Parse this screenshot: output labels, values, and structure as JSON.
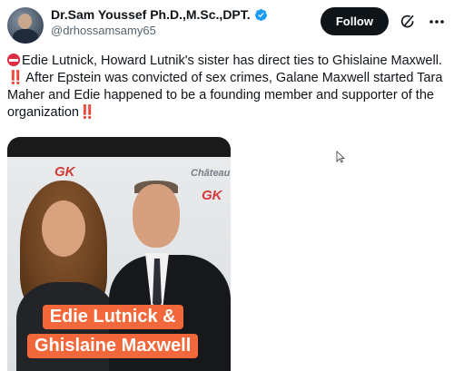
{
  "author": {
    "display_name": "Dr.Sam Youssef Ph.D.,M.Sc.,DPT.",
    "handle": "@drhossamsamy65",
    "verified": true,
    "avatar_icon": "profile-photo"
  },
  "actions": {
    "follow_label": "Follow",
    "grok_icon": "grok-icon",
    "more_icon": "more-dots-icon"
  },
  "post": {
    "paragraph_1": "Edie Lutnick, Howard Lutnik's sister has direct ties to Ghislaine Maxwell.",
    "paragraph_2": "After Epstein was convicted of sex crimes, Galane Maxwell started Tara Maher and Edie happened to be a founding member and supporter of the organization",
    "bang": "‼️"
  },
  "media": {
    "caption_line_1": "Edie Lutnick &",
    "caption_line_2": "Ghislaine Maxwell",
    "backdrop_logo_gk": "GK",
    "backdrop_logo_chateau": "Château",
    "caption_color": "#f2683a"
  },
  "colors": {
    "text_primary": "#0f1419",
    "text_secondary": "#536471",
    "verified_blue": "#1d9bf0",
    "follow_bg": "#0f1419",
    "bang_red": "#e0243a"
  }
}
